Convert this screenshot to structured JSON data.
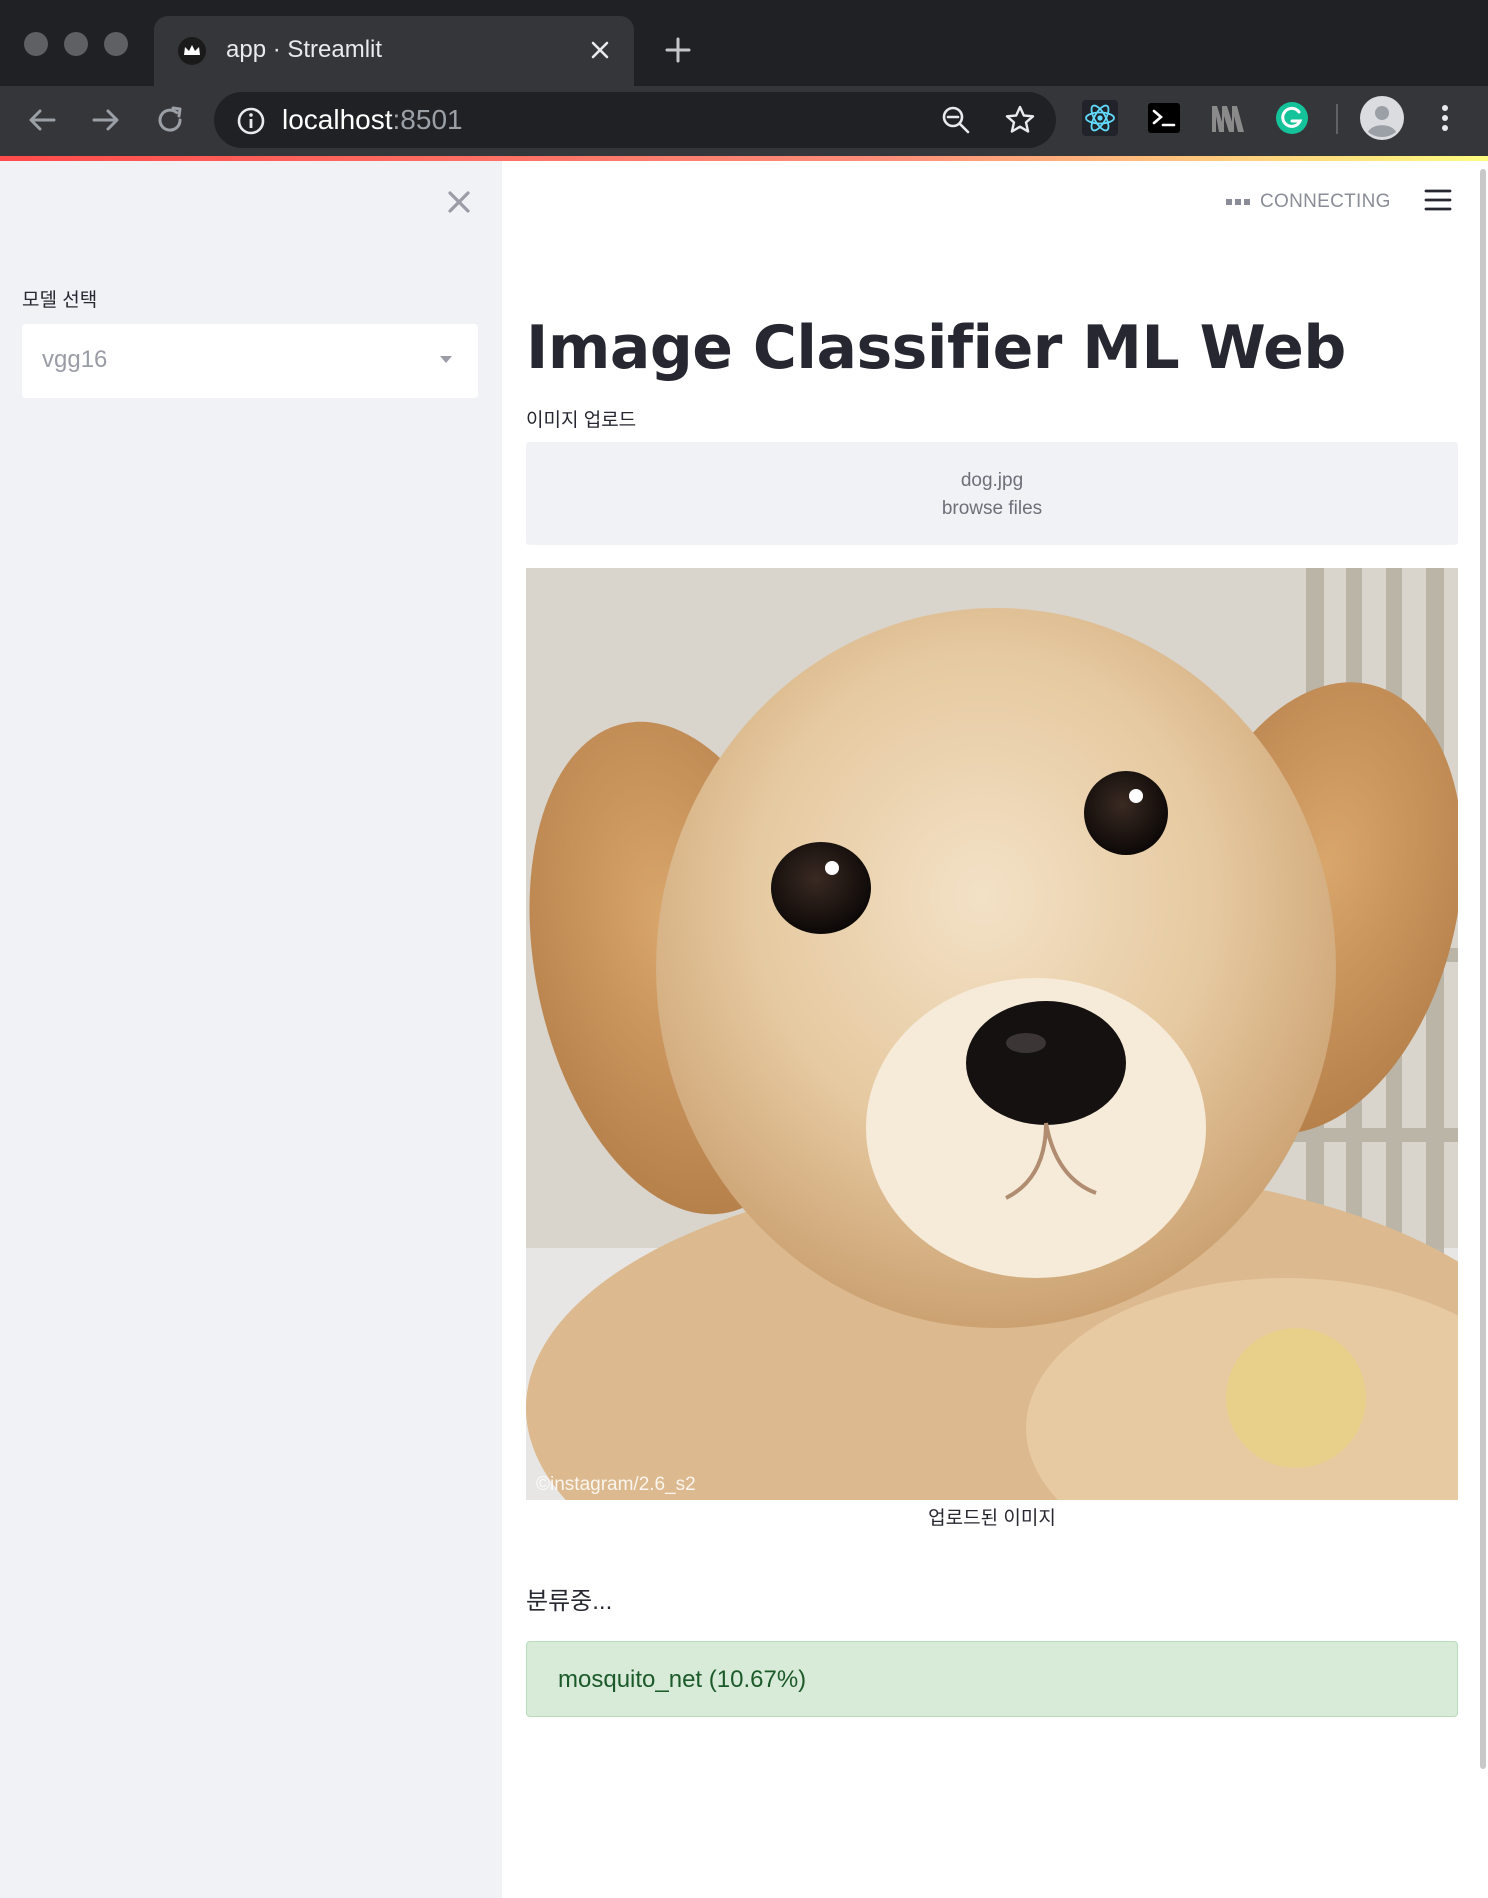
{
  "browser": {
    "tab_title": "app · Streamlit",
    "url_host": "localhost",
    "url_port": ":8501"
  },
  "sidebar": {
    "model_label": "모델 선택",
    "model_selected": "vgg16"
  },
  "header": {
    "status": "CONNECTING"
  },
  "main": {
    "title": "Image Classifier ML Web",
    "upload_label": "이미지 업로드",
    "uploaded_file": "dog.jpg",
    "browse_label": "browse files",
    "image_credit": "©instagram/2.6_s2",
    "image_caption": "업로드된  이미지",
    "progress_text": "분류중...",
    "result": "mosquito_net (10.67%)"
  },
  "colors": {
    "accent": "#ff4b4b",
    "sidebar_bg": "#f0f2f6",
    "success_bg": "#d8ead8",
    "success_text": "#1c5a2a"
  }
}
